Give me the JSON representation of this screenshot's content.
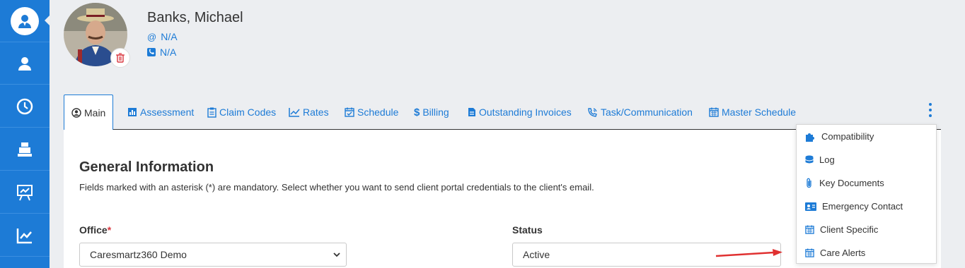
{
  "sidebar": {
    "items": [
      {
        "icon": "client-avatar-icon",
        "active": true
      },
      {
        "icon": "user-icon"
      },
      {
        "icon": "clock-icon"
      },
      {
        "icon": "cash-register-icon"
      },
      {
        "icon": "presentation-icon"
      },
      {
        "icon": "line-chart-icon"
      }
    ]
  },
  "header": {
    "name": "Banks, Michael",
    "email": "N/A",
    "phone": "N/A"
  },
  "tabs": [
    {
      "label": "Main",
      "icon": "user-circle-icon",
      "active": true
    },
    {
      "label": "Assessment",
      "icon": "bar-chart-icon"
    },
    {
      "label": "Claim Codes",
      "icon": "clipboard-icon"
    },
    {
      "label": "Rates",
      "icon": "trend-icon"
    },
    {
      "label": "Schedule",
      "icon": "calendar-check-icon"
    },
    {
      "label": "Billing",
      "icon": "dollar-icon"
    },
    {
      "label": "Outstanding Invoices",
      "icon": "document-icon"
    },
    {
      "label": "Task/Communication",
      "icon": "phone-volume-icon"
    },
    {
      "label": "Master Schedule",
      "icon": "calendar-icon"
    }
  ],
  "main": {
    "title": "General Information",
    "description": "Fields marked with an asterisk (*) are mandatory. Select whether you want to send client portal credentials to the client's email.",
    "office_label": "Office",
    "office_required": "*",
    "office_value": "Caresmartz360 Demo",
    "status_label": "Status",
    "status_value": "Active"
  },
  "menu": {
    "items": [
      {
        "label": "Compatibility",
        "icon": "puzzle-icon"
      },
      {
        "label": "Log",
        "icon": "database-icon"
      },
      {
        "label": "Key Documents",
        "icon": "paperclip-icon"
      },
      {
        "label": "Emergency Contact",
        "icon": "id-card-icon"
      },
      {
        "label": "Client Specific",
        "icon": "calendar-icon"
      },
      {
        "label": "Care Alerts",
        "icon": "calendar-icon"
      }
    ]
  },
  "colors": {
    "primary": "#1d7bd6",
    "sidebar": "#1d7bd6",
    "danger": "#d9363e",
    "arrow": "#e03131"
  }
}
